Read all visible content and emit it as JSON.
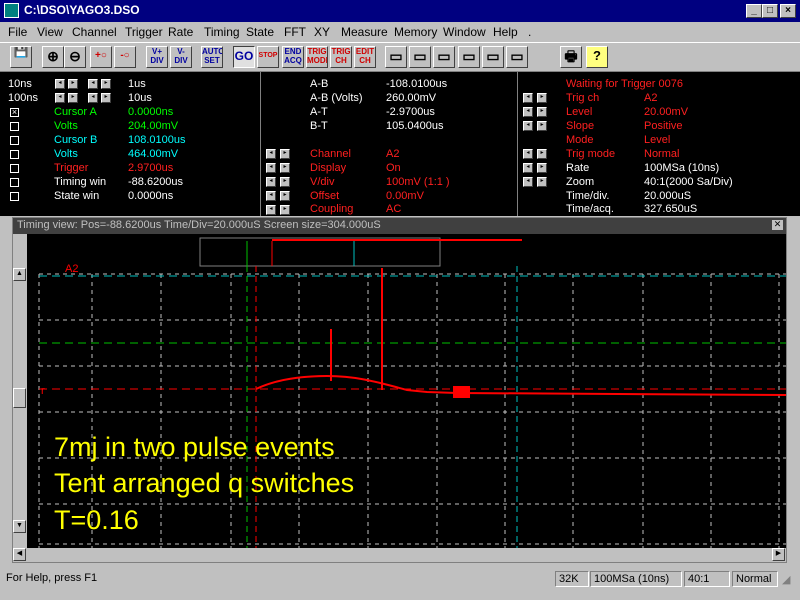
{
  "window": {
    "title": "C:\\DSO\\YAGO3.DSO",
    "buttons": [
      "_",
      "□",
      "×"
    ]
  },
  "menu": [
    "File",
    "View",
    "Channel",
    "Trigger",
    "Rate",
    "Timing",
    "State",
    "FFT",
    "XY",
    "Measure",
    "Memory",
    "Window",
    "Help",
    "."
  ],
  "toolbar": [
    {
      "name": "save",
      "label": "💾"
    },
    {
      "name": "zoom-in",
      "label": "⊕"
    },
    {
      "name": "zoom-out",
      "label": "⊖"
    },
    {
      "name": "cursor-add",
      "label": "+○"
    },
    {
      "name": "cursor-remove",
      "label": "-○"
    },
    {
      "name": "v-plus-div",
      "label": "V+ DIV"
    },
    {
      "name": "v-minus-div",
      "label": "V- DIV"
    },
    {
      "name": "auto-set",
      "label": "AUTO SET"
    },
    {
      "name": "go",
      "label": "GO"
    },
    {
      "name": "stop",
      "label": "STOP"
    },
    {
      "name": "end-acq",
      "label": "END ACQ"
    },
    {
      "name": "trig-mode",
      "label": "TRIG MODE"
    },
    {
      "name": "trig-ch",
      "label": "TRIG CH"
    },
    {
      "name": "edit-ch",
      "label": "EDIT CH"
    },
    {
      "name": "view1",
      "label": "▭"
    },
    {
      "name": "view2",
      "label": "▭"
    },
    {
      "name": "view3",
      "label": "▭"
    },
    {
      "name": "view4",
      "label": "▭"
    },
    {
      "name": "view5",
      "label": "▭"
    },
    {
      "name": "view6",
      "label": "▭"
    },
    {
      "name": "print",
      "label": "🖶"
    },
    {
      "name": "help",
      "label": "?"
    }
  ],
  "left_panel": {
    "timebase": [
      {
        "left": "10ns",
        "right": "1us"
      },
      {
        "left": "100ns",
        "right": "10us"
      }
    ],
    "rows": [
      {
        "label": "Cursor A",
        "value": "0.0000ns",
        "color": "g",
        "checked": true
      },
      {
        "label": "Volts",
        "value": "204.00mV",
        "color": "g",
        "checked": false
      },
      {
        "label": "Cursor B",
        "value": "108.0100us",
        "color": "c",
        "checked": false
      },
      {
        "label": "Volts",
        "value": "464.00mV",
        "color": "c",
        "checked": false
      },
      {
        "label": "Trigger",
        "value": "2.9700us",
        "color": "r",
        "checked": false
      },
      {
        "label": "Timing win",
        "value": "-88.6200us",
        "color": "w",
        "checked": false
      },
      {
        "label": "State win",
        "value": "0.0000ns",
        "color": "w",
        "checked": false
      }
    ]
  },
  "middle_panel": {
    "measurements": [
      {
        "label": "A-B",
        "value": "-108.0100us"
      },
      {
        "label": "A-B (Volts)",
        "value": "260.00mV"
      },
      {
        "label": "A-T",
        "value": "-2.9700us"
      },
      {
        "label": "B-T",
        "value": "105.0400us"
      }
    ],
    "channel": [
      {
        "label": "Channel",
        "value": "A2"
      },
      {
        "label": "Display",
        "value": "On"
      },
      {
        "label": "V/div",
        "value": "100mV (1:1  )"
      },
      {
        "label": "Offset",
        "value": "0.00mV"
      },
      {
        "label": "Coupling",
        "value": "AC"
      }
    ]
  },
  "right_panel": {
    "status": "Waiting for Trigger 0076",
    "trigger": [
      {
        "label": "Trig ch",
        "value": "A2"
      },
      {
        "label": "Level",
        "value": "20.00mV"
      },
      {
        "label": "Slope",
        "value": "Positive"
      },
      {
        "label": "Mode",
        "value": "Level"
      },
      {
        "label": "Trig mode",
        "value": "Normal"
      }
    ],
    "acquisition": [
      {
        "label": "Rate",
        "value": "100MSa (10ns)"
      },
      {
        "label": "Zoom",
        "value": "40:1(2000 Sa/Div)"
      },
      {
        "label": "Time/div.",
        "value": "20.000uS"
      },
      {
        "label": "Time/acq.",
        "value": "327.650uS"
      }
    ]
  },
  "scope": {
    "header": "Timing view: Pos=-88.6200us Time/Div=20.000uS Screen size=304.000uS",
    "channel_label": "A2",
    "annotation": [
      "7mj in two pulse events",
      "Tent arranged q switches",
      "T=0.16"
    ],
    "colors": {
      "trace": "#ff0000",
      "cursorA": "#00c000",
      "cursorB": "#00c0c0",
      "grid": "#c0c0c0",
      "annotation": "#ffff00"
    }
  },
  "statusbar": {
    "help": "For Help, press F1",
    "memory": "32K",
    "rate": "100MSa (10ns)",
    "zoom": "40:1",
    "mode": "Normal"
  }
}
